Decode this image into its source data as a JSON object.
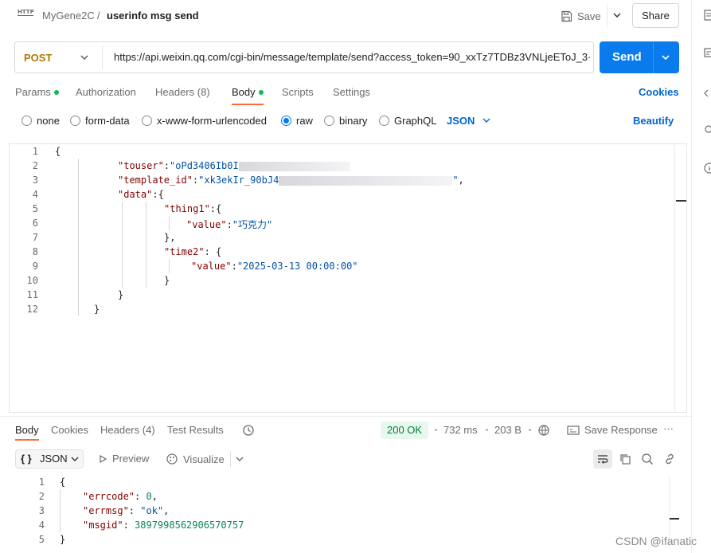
{
  "breadcrumb": {
    "icon_label": "HTTP",
    "collection": "MyGene2C",
    "separator": "/",
    "request": "userinfo msg send"
  },
  "header_actions": {
    "save_label": "Save",
    "share_label": "Share"
  },
  "request": {
    "method": "POST",
    "url": "https://api.weixin.qq.com/cgi-bin/message/template/send?access_token=90_xxTz7TDBz3VNLjeEToJ_3···",
    "send_label": "Send"
  },
  "request_tabs": [
    {
      "label": "Params",
      "has_dot": true,
      "active": false
    },
    {
      "label": "Authorization",
      "has_dot": false,
      "active": false
    },
    {
      "label": "Headers (8)",
      "has_dot": false,
      "active": false
    },
    {
      "label": "Body",
      "has_dot": true,
      "active": true
    },
    {
      "label": "Scripts",
      "has_dot": false,
      "active": false
    },
    {
      "label": "Settings",
      "has_dot": false,
      "active": false
    }
  ],
  "cookies_link": "Cookies",
  "body_types": [
    {
      "label": "none",
      "selected": false
    },
    {
      "label": "form-data",
      "selected": false
    },
    {
      "label": "x-www-form-urlencoded",
      "selected": false
    },
    {
      "label": "raw",
      "selected": true
    },
    {
      "label": "binary",
      "selected": false
    },
    {
      "label": "GraphQL",
      "selected": false
    }
  ],
  "raw_format": "JSON",
  "beautify_label": "Beautify",
  "request_body": {
    "line_numbers": [
      "1",
      "2",
      "3",
      "4",
      "5",
      "6",
      "7",
      "8",
      "9",
      "10",
      "11",
      "12"
    ],
    "touser_key": "\"touser\"",
    "touser_value": "\"oPd3406Ib0I",
    "template_key": "\"template_id\"",
    "template_value": "\"xk3ekIr_90bJ4",
    "data_key": "\"data\"",
    "thing1_key": "\"thing1\"",
    "thing1_value_key": "\"value\"",
    "thing1_value": "\"巧克力\"",
    "time2_key": "\"time2\"",
    "time2_value_key": "\"value\"",
    "time2_value": "\"2025-03-13 00:00:00\""
  },
  "response_tabs": [
    {
      "label": "Body",
      "active": true
    },
    {
      "label": "Cookies",
      "active": false
    },
    {
      "label": "Headers (4)",
      "active": false
    },
    {
      "label": "Test Results",
      "active": false
    }
  ],
  "response_meta": {
    "status": "200 OK",
    "time": "732 ms",
    "size": "203 B",
    "save_response": "Save Response",
    "more": "···"
  },
  "response_toolbar": {
    "format": "JSON",
    "preview": "Preview",
    "visualize": "Visualize"
  },
  "response_body": {
    "line_numbers": [
      "1",
      "2",
      "3",
      "4",
      "5"
    ],
    "errcode_key": "\"errcode\"",
    "errcode_value": "0",
    "errmsg_key": "\"errmsg\"",
    "errmsg_value": "\"ok\"",
    "msgid_key": "\"msgid\"",
    "msgid_value": "3897998562906570757"
  },
  "watermark": "CSDN @ifanatic",
  "colors": {
    "accent_blue": "#097bed",
    "method_post": "#ad7a03",
    "tab_active_underline": "#ff6c37",
    "status_ok": "#007f31",
    "dot_green": "#0cbb52"
  }
}
